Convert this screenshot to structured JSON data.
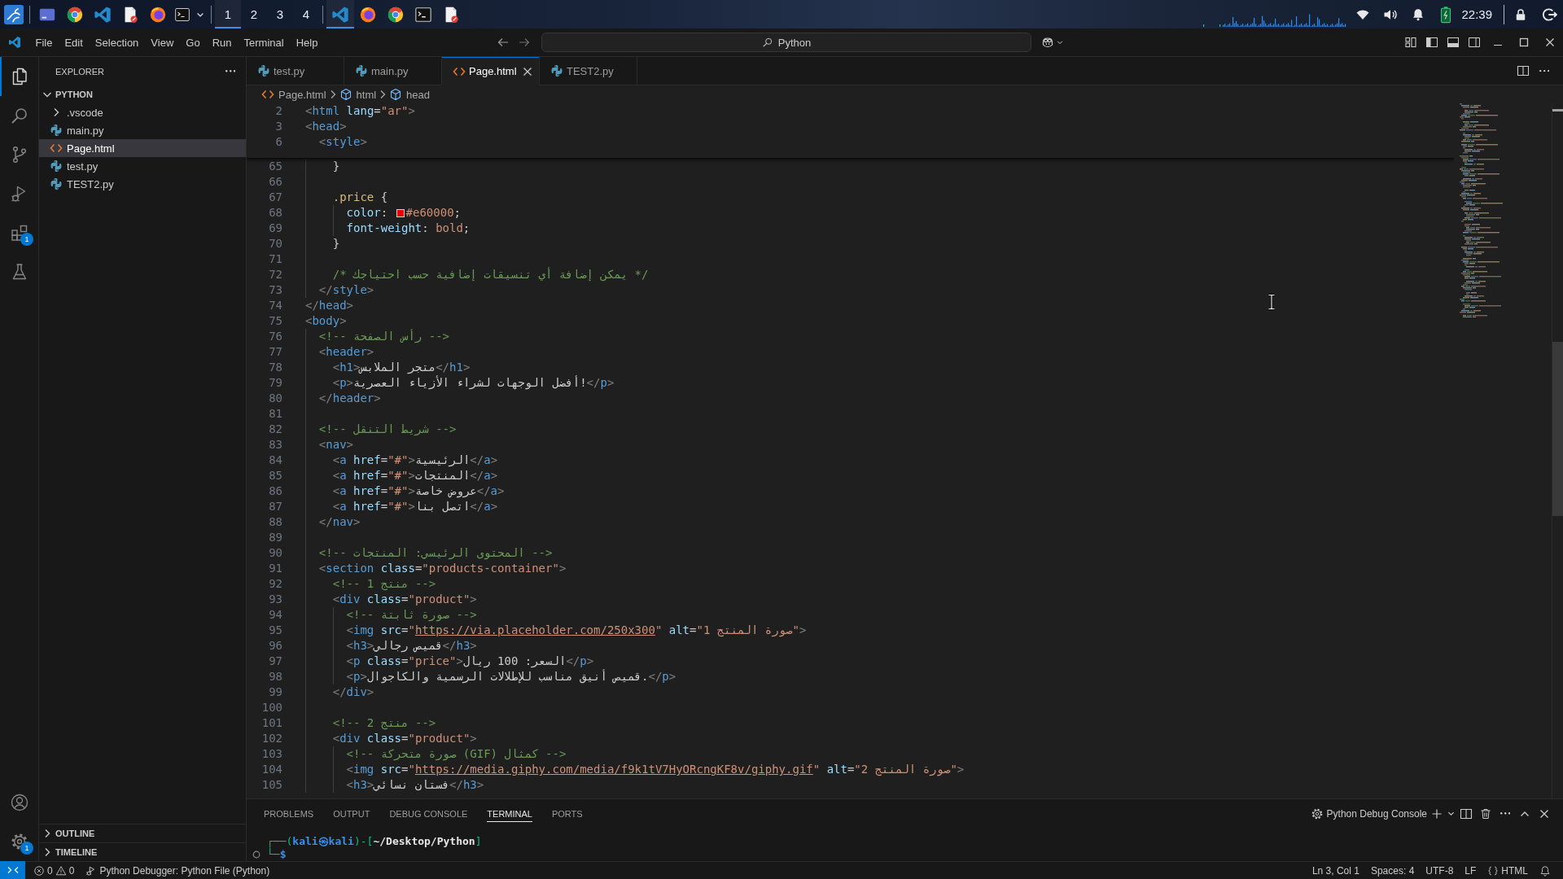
{
  "taskbar": {
    "workspaces": [
      {
        "label": "1",
        "selected": true
      },
      {
        "label": "2",
        "selected": false
      },
      {
        "label": "3",
        "selected": false
      },
      {
        "label": "4",
        "selected": false
      }
    ],
    "windows": [
      {
        "kind": "code",
        "selected": true
      },
      {
        "kind": "fox",
        "selected": false
      },
      {
        "kind": "globe",
        "selected": false
      },
      {
        "kind": "terminal",
        "selected": false
      },
      {
        "kind": "document",
        "selected": false
      }
    ],
    "clock": "22:39"
  },
  "window": {
    "menu": [
      "File",
      "Edit",
      "Selection",
      "View",
      "Go",
      "Run",
      "Terminal",
      "Help"
    ],
    "command_center": {
      "label": "Python"
    }
  },
  "activity_bar": {
    "items": [
      {
        "kind": "explorer",
        "selected": true
      },
      {
        "kind": "search",
        "selected": false
      },
      {
        "kind": "source_control",
        "selected": false
      },
      {
        "kind": "run_debug",
        "selected": false
      },
      {
        "kind": "extensions",
        "selected": false,
        "badge": "1"
      },
      {
        "kind": "testing",
        "selected": false
      }
    ],
    "bottom": [
      {
        "kind": "accounts"
      },
      {
        "kind": "manage",
        "badge": "1"
      }
    ]
  },
  "sidebar": {
    "title": "EXPLORER",
    "sections": [
      {
        "title": "PYTHON",
        "expanded": true,
        "items": [
          {
            "name": ".vscode",
            "kind": "folder",
            "expanded": false,
            "selected": false
          },
          {
            "name": "main.py",
            "kind": "python",
            "selected": false
          },
          {
            "name": "Page.html",
            "kind": "html",
            "selected": true
          },
          {
            "name": "test.py",
            "kind": "python",
            "selected": false
          },
          {
            "name": "TEST2.py",
            "kind": "python",
            "selected": false
          }
        ]
      },
      {
        "title": "OUTLINE",
        "expanded": false
      },
      {
        "title": "TIMELINE",
        "expanded": false
      }
    ]
  },
  "editor": {
    "tabs": [
      {
        "label": "test.py",
        "kind": "python",
        "selected": false
      },
      {
        "label": "main.py",
        "kind": "python",
        "selected": false
      },
      {
        "label": "Page.html",
        "kind": "html",
        "selected": true
      },
      {
        "label": "TEST2.py",
        "kind": "python",
        "selected": false
      }
    ],
    "breadcrumbs": [
      {
        "label": "Page.html",
        "kind": "html"
      },
      {
        "label": "html",
        "kind": "element"
      },
      {
        "label": "head",
        "kind": "element"
      }
    ],
    "sticky_lines": [
      {
        "number": "2",
        "tokens": [
          {
            "kind": "bracket",
            "text": "<"
          },
          {
            "kind": "tag",
            "text": "html "
          },
          {
            "kind": "attribute",
            "text": "lang"
          },
          {
            "kind": "text",
            "text": "="
          },
          {
            "kind": "string",
            "text": "\"ar\""
          },
          {
            "kind": "bracket",
            "text": ">"
          }
        ]
      },
      {
        "number": "3",
        "tokens": [
          {
            "kind": "bracket",
            "text": "<"
          },
          {
            "kind": "tag",
            "text": "head"
          },
          {
            "kind": "bracket",
            "text": ">"
          }
        ]
      },
      {
        "number": "6",
        "tokens": [
          {
            "kind": "bracket",
            "text": "  <"
          },
          {
            "kind": "tag",
            "text": "style"
          },
          {
            "kind": "bracket",
            "text": ">"
          }
        ]
      }
    ],
    "lines": [
      {
        "number": "65",
        "tokens": [
          {
            "kind": "text",
            "text": "    }"
          }
        ]
      },
      {
        "number": "66"
      },
      {
        "number": "67",
        "tokens": [
          {
            "kind": "selector",
            "text": "    .price "
          },
          {
            "kind": "text",
            "text": "{"
          }
        ]
      },
      {
        "number": "68",
        "tokens": [
          {
            "kind": "property",
            "text": "      color"
          },
          {
            "kind": "text",
            "text": ": "
          },
          {
            "kind": "swatch",
            "color": "#e60000"
          },
          {
            "kind": "value",
            "text": "#e60000"
          },
          {
            "kind": "text",
            "text": ";"
          }
        ]
      },
      {
        "number": "69",
        "tokens": [
          {
            "kind": "property",
            "text": "      font-weight"
          },
          {
            "kind": "text",
            "text": ": "
          },
          {
            "kind": "value",
            "text": "bold"
          },
          {
            "kind": "text",
            "text": ";"
          }
        ]
      },
      {
        "number": "70",
        "tokens": [
          {
            "kind": "text",
            "text": "    }"
          }
        ]
      },
      {
        "number": "71"
      },
      {
        "number": "72",
        "tokens": [
          {
            "kind": "comment",
            "text": "    /* يمكن إضافة أي تنسيقات إضافية حسب احتياجك */"
          }
        ]
      },
      {
        "number": "73",
        "tokens": [
          {
            "kind": "bracket",
            "text": "  </"
          },
          {
            "kind": "tag",
            "text": "style"
          },
          {
            "kind": "bracket",
            "text": ">"
          }
        ]
      },
      {
        "number": "74",
        "tokens": [
          {
            "kind": "bracket",
            "text": "</"
          },
          {
            "kind": "tag",
            "text": "head"
          },
          {
            "kind": "bracket",
            "text": ">"
          }
        ]
      },
      {
        "number": "75",
        "tokens": [
          {
            "kind": "bracket",
            "text": "<"
          },
          {
            "kind": "tag",
            "text": "body"
          },
          {
            "kind": "bracket",
            "text": ">"
          }
        ]
      },
      {
        "number": "76",
        "tokens": [
          {
            "kind": "comment",
            "text": "  <!-- رأس الصفحة -->"
          }
        ]
      },
      {
        "number": "77",
        "tokens": [
          {
            "kind": "bracket",
            "text": "  <"
          },
          {
            "kind": "tag",
            "text": "header"
          },
          {
            "kind": "bracket",
            "text": ">"
          }
        ]
      },
      {
        "number": "78",
        "tokens": [
          {
            "kind": "bracket",
            "text": "    <"
          },
          {
            "kind": "tag",
            "text": "h1"
          },
          {
            "kind": "bracket",
            "text": ">"
          },
          {
            "kind": "text",
            "text": "متجر الملابس"
          },
          {
            "kind": "bracket",
            "text": "</"
          },
          {
            "kind": "tag",
            "text": "h1"
          },
          {
            "kind": "bracket",
            "text": ">"
          }
        ]
      },
      {
        "number": "79",
        "tokens": [
          {
            "kind": "bracket",
            "text": "    <"
          },
          {
            "kind": "tag",
            "text": "p"
          },
          {
            "kind": "bracket",
            "text": ">"
          },
          {
            "kind": "text",
            "text": "أفضل الوجهات لشراء الأزياء العصرية!"
          },
          {
            "kind": "bracket",
            "text": "</"
          },
          {
            "kind": "tag",
            "text": "p"
          },
          {
            "kind": "bracket",
            "text": ">"
          }
        ]
      },
      {
        "number": "80",
        "tokens": [
          {
            "kind": "bracket",
            "text": "  </"
          },
          {
            "kind": "tag",
            "text": "header"
          },
          {
            "kind": "bracket",
            "text": ">"
          }
        ]
      },
      {
        "number": "81"
      },
      {
        "number": "82",
        "tokens": [
          {
            "kind": "comment",
            "text": "  <!-- شريط التنقل -->"
          }
        ]
      },
      {
        "number": "83",
        "tokens": [
          {
            "kind": "bracket",
            "text": "  <"
          },
          {
            "kind": "tag",
            "text": "nav"
          },
          {
            "kind": "bracket",
            "text": ">"
          }
        ]
      },
      {
        "number": "84",
        "tokens": [
          {
            "kind": "bracket",
            "text": "    <"
          },
          {
            "kind": "tag",
            "text": "a "
          },
          {
            "kind": "attribute",
            "text": "href"
          },
          {
            "kind": "text",
            "text": "="
          },
          {
            "kind": "string",
            "text": "\"#\""
          },
          {
            "kind": "bracket",
            "text": ">"
          },
          {
            "kind": "text",
            "text": "الرئيسية"
          },
          {
            "kind": "bracket",
            "text": "</"
          },
          {
            "kind": "tag",
            "text": "a"
          },
          {
            "kind": "bracket",
            "text": ">"
          }
        ]
      },
      {
        "number": "85",
        "tokens": [
          {
            "kind": "bracket",
            "text": "    <"
          },
          {
            "kind": "tag",
            "text": "a "
          },
          {
            "kind": "attribute",
            "text": "href"
          },
          {
            "kind": "text",
            "text": "="
          },
          {
            "kind": "string",
            "text": "\"#\""
          },
          {
            "kind": "bracket",
            "text": ">"
          },
          {
            "kind": "text",
            "text": "المنتجات"
          },
          {
            "kind": "bracket",
            "text": "</"
          },
          {
            "kind": "tag",
            "text": "a"
          },
          {
            "kind": "bracket",
            "text": ">"
          }
        ]
      },
      {
        "number": "86",
        "tokens": [
          {
            "kind": "bracket",
            "text": "    <"
          },
          {
            "kind": "tag",
            "text": "a "
          },
          {
            "kind": "attribute",
            "text": "href"
          },
          {
            "kind": "text",
            "text": "="
          },
          {
            "kind": "string",
            "text": "\"#\""
          },
          {
            "kind": "bracket",
            "text": ">"
          },
          {
            "kind": "text",
            "text": "عروض خاصة"
          },
          {
            "kind": "bracket",
            "text": "</"
          },
          {
            "kind": "tag",
            "text": "a"
          },
          {
            "kind": "bracket",
            "text": ">"
          }
        ]
      },
      {
        "number": "87",
        "tokens": [
          {
            "kind": "bracket",
            "text": "    <"
          },
          {
            "kind": "tag",
            "text": "a "
          },
          {
            "kind": "attribute",
            "text": "href"
          },
          {
            "kind": "text",
            "text": "="
          },
          {
            "kind": "string",
            "text": "\"#\""
          },
          {
            "kind": "bracket",
            "text": ">"
          },
          {
            "kind": "text",
            "text": "اتصل بنا"
          },
          {
            "kind": "bracket",
            "text": "</"
          },
          {
            "kind": "tag",
            "text": "a"
          },
          {
            "kind": "bracket",
            "text": ">"
          }
        ]
      },
      {
        "number": "88",
        "tokens": [
          {
            "kind": "bracket",
            "text": "  </"
          },
          {
            "kind": "tag",
            "text": "nav"
          },
          {
            "kind": "bracket",
            "text": ">"
          }
        ]
      },
      {
        "number": "89"
      },
      {
        "number": "90",
        "tokens": [
          {
            "kind": "comment",
            "text": "  <!-- المحتوى الرئيسي: المنتجات -->"
          }
        ]
      },
      {
        "number": "91",
        "tokens": [
          {
            "kind": "bracket",
            "text": "  <"
          },
          {
            "kind": "tag",
            "text": "section "
          },
          {
            "kind": "attribute",
            "text": "class"
          },
          {
            "kind": "text",
            "text": "="
          },
          {
            "kind": "string",
            "text": "\"products-container\""
          },
          {
            "kind": "bracket",
            "text": ">"
          }
        ]
      },
      {
        "number": "92",
        "tokens": [
          {
            "kind": "comment",
            "text": "    <!-- منتج 1 -->"
          }
        ]
      },
      {
        "number": "93",
        "tokens": [
          {
            "kind": "bracket",
            "text": "    <"
          },
          {
            "kind": "tag",
            "text": "div "
          },
          {
            "kind": "attribute",
            "text": "class"
          },
          {
            "kind": "text",
            "text": "="
          },
          {
            "kind": "string",
            "text": "\"product\""
          },
          {
            "kind": "bracket",
            "text": ">"
          }
        ]
      },
      {
        "number": "94",
        "tokens": [
          {
            "kind": "comment",
            "text": "      <!-- صورة ثابتة -->"
          }
        ]
      },
      {
        "number": "95",
        "tokens": [
          {
            "kind": "bracket",
            "text": "      <"
          },
          {
            "kind": "tag",
            "text": "img "
          },
          {
            "kind": "attribute",
            "text": "src"
          },
          {
            "kind": "text",
            "text": "="
          },
          {
            "kind": "string",
            "text": "\""
          },
          {
            "kind": "link",
            "text": "https://via.placeholder.com/250x300"
          },
          {
            "kind": "string",
            "text": "\" "
          },
          {
            "kind": "attribute",
            "text": "alt"
          },
          {
            "kind": "text",
            "text": "="
          },
          {
            "kind": "string",
            "text": "\"صورة المنتج 1\""
          },
          {
            "kind": "bracket",
            "text": ">"
          }
        ]
      },
      {
        "number": "96",
        "tokens": [
          {
            "kind": "bracket",
            "text": "      <"
          },
          {
            "kind": "tag",
            "text": "h3"
          },
          {
            "kind": "bracket",
            "text": ">"
          },
          {
            "kind": "text",
            "text": "قميص رجالي"
          },
          {
            "kind": "bracket",
            "text": "</"
          },
          {
            "kind": "tag",
            "text": "h3"
          },
          {
            "kind": "bracket",
            "text": ">"
          }
        ]
      },
      {
        "number": "97",
        "tokens": [
          {
            "kind": "bracket",
            "text": "      <"
          },
          {
            "kind": "tag",
            "text": "p "
          },
          {
            "kind": "attribute",
            "text": "class"
          },
          {
            "kind": "text",
            "text": "="
          },
          {
            "kind": "string",
            "text": "\"price\""
          },
          {
            "kind": "bracket",
            "text": ">"
          },
          {
            "kind": "text",
            "text": "السعر: 100 ريال"
          },
          {
            "kind": "bracket",
            "text": "</"
          },
          {
            "kind": "tag",
            "text": "p"
          },
          {
            "kind": "bracket",
            "text": ">"
          }
        ]
      },
      {
        "number": "98",
        "tokens": [
          {
            "kind": "bracket",
            "text": "      <"
          },
          {
            "kind": "tag",
            "text": "p"
          },
          {
            "kind": "bracket",
            "text": ">"
          },
          {
            "kind": "text",
            "text": "قميص أنيق مناسب للإطلالات الرسمية والكاجوال."
          },
          {
            "kind": "bracket",
            "text": "</"
          },
          {
            "kind": "tag",
            "text": "p"
          },
          {
            "kind": "bracket",
            "text": ">"
          }
        ]
      },
      {
        "number": "99",
        "tokens": [
          {
            "kind": "bracket",
            "text": "    </"
          },
          {
            "kind": "tag",
            "text": "div"
          },
          {
            "kind": "bracket",
            "text": ">"
          }
        ]
      },
      {
        "number": "100"
      },
      {
        "number": "101",
        "tokens": [
          {
            "kind": "comment",
            "text": "    <!-- منتج 2 -->"
          }
        ]
      },
      {
        "number": "102",
        "tokens": [
          {
            "kind": "bracket",
            "text": "    <"
          },
          {
            "kind": "tag",
            "text": "div "
          },
          {
            "kind": "attribute",
            "text": "class"
          },
          {
            "kind": "text",
            "text": "="
          },
          {
            "kind": "string",
            "text": "\"product\""
          },
          {
            "kind": "bracket",
            "text": ">"
          }
        ]
      },
      {
        "number": "103",
        "tokens": [
          {
            "kind": "comment",
            "text": "      <!-- صورة متحركة (GIF) كمثال -->"
          }
        ]
      },
      {
        "number": "104",
        "tokens": [
          {
            "kind": "bracket",
            "text": "      <"
          },
          {
            "kind": "tag",
            "text": "img "
          },
          {
            "kind": "attribute",
            "text": "src"
          },
          {
            "kind": "text",
            "text": "="
          },
          {
            "kind": "string",
            "text": "\""
          },
          {
            "kind": "link",
            "text": "https://media.giphy.com/media/f9k1tV7HyORcngKF8v/giphy.gif"
          },
          {
            "kind": "string",
            "text": "\" "
          },
          {
            "kind": "attribute",
            "text": "alt"
          },
          {
            "kind": "text",
            "text": "="
          },
          {
            "kind": "string",
            "text": "\"صورة المنتج 2\""
          },
          {
            "kind": "bracket",
            "text": ">"
          }
        ]
      },
      {
        "number": "105",
        "tokens": [
          {
            "kind": "bracket",
            "text": "      <"
          },
          {
            "kind": "tag",
            "text": "h3"
          },
          {
            "kind": "bracket",
            "text": ">"
          },
          {
            "kind": "text",
            "text": "فستان نسائي"
          },
          {
            "kind": "bracket",
            "text": "</"
          },
          {
            "kind": "tag",
            "text": "h3"
          },
          {
            "kind": "bracket",
            "text": ">"
          }
        ]
      }
    ]
  },
  "panel": {
    "tabs": [
      {
        "label": "PROBLEMS",
        "selected": false
      },
      {
        "label": "OUTPUT",
        "selected": false
      },
      {
        "label": "DEBUG CONSOLE",
        "selected": false
      },
      {
        "label": "TERMINAL",
        "selected": true
      },
      {
        "label": "PORTS",
        "selected": false
      }
    ],
    "terminal_name": "Python Debug Console",
    "terminal_lines": [
      {
        "decorated": false,
        "tokens": [
          {
            "kind": "frame",
            "text": "┌──("
          },
          {
            "kind": "host",
            "text": "kali㉿kali"
          },
          {
            "kind": "frame",
            "text": ")-["
          },
          {
            "kind": "path",
            "text": "~/Desktop/Python"
          },
          {
            "kind": "frame",
            "text": "]"
          }
        ]
      },
      {
        "decorated": true,
        "tokens": [
          {
            "kind": "frame",
            "text": "└─"
          },
          {
            "kind": "prompt",
            "text": "$"
          }
        ]
      }
    ]
  },
  "status_bar": {
    "problems": [
      {
        "kind": "error",
        "count": "0"
      },
      {
        "kind": "warning",
        "count": "0"
      }
    ],
    "debug": "Python Debugger: Python File (Python)",
    "items": [
      {
        "kind": "text",
        "text": "Ln 3, Col 1"
      },
      {
        "kind": "text",
        "text": "Spaces: 4"
      },
      {
        "kind": "text",
        "text": "UTF-8"
      },
      {
        "kind": "text",
        "text": "LF"
      },
      {
        "kind": "language",
        "text": "HTML"
      }
    ]
  }
}
